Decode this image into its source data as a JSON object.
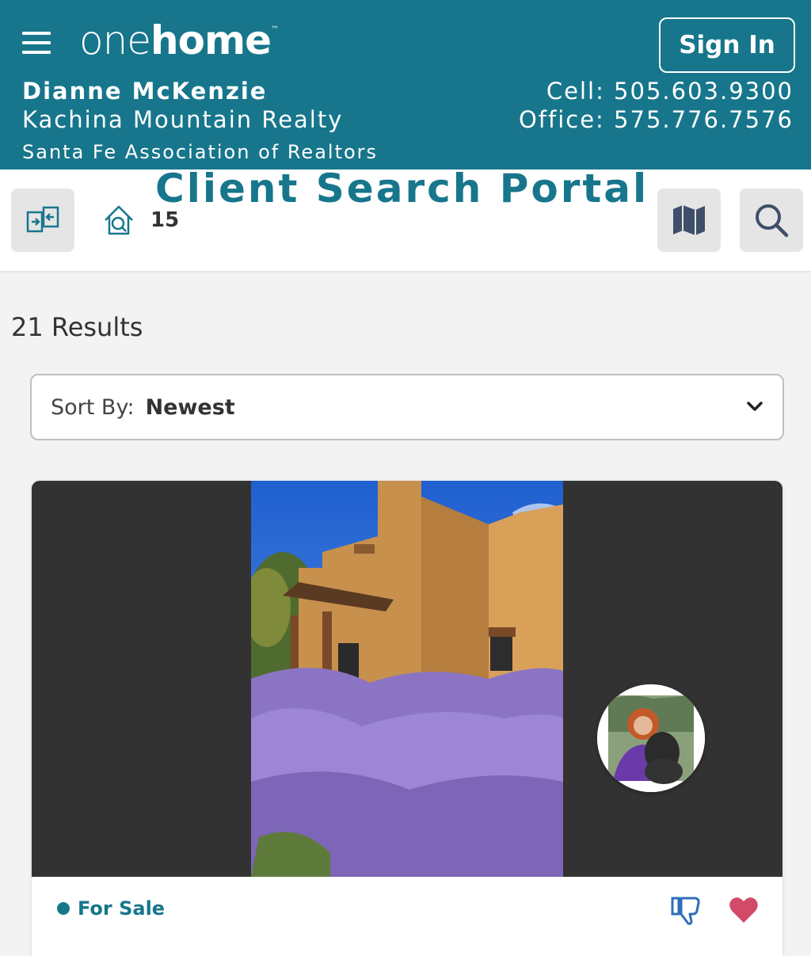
{
  "header": {
    "logo_one": "one",
    "logo_home": "home",
    "logo_tm": "™",
    "sign_in_label": "Sign In",
    "agent_name": "Dianne McKenzie",
    "agent_company": "Kachina Mountain Realty",
    "agent_association": "Santa Fe Association of Realtors",
    "cell": "Cell: 505.603.9300",
    "office": "Office: 575.776.7576",
    "brand_color": "#17768c"
  },
  "toolbar": {
    "portal_title": "Client Search Portal",
    "saved_homes_count": "15",
    "icons": [
      "compare-icon",
      "home-search-icon",
      "map-icon",
      "search-icon"
    ]
  },
  "main": {
    "results_text": "21 Results",
    "sort_label": "Sort By:",
    "sort_value": "Newest"
  },
  "listing": {
    "status": "For Sale",
    "status_color": "#17768c",
    "favorite_color": "#d14a68"
  }
}
